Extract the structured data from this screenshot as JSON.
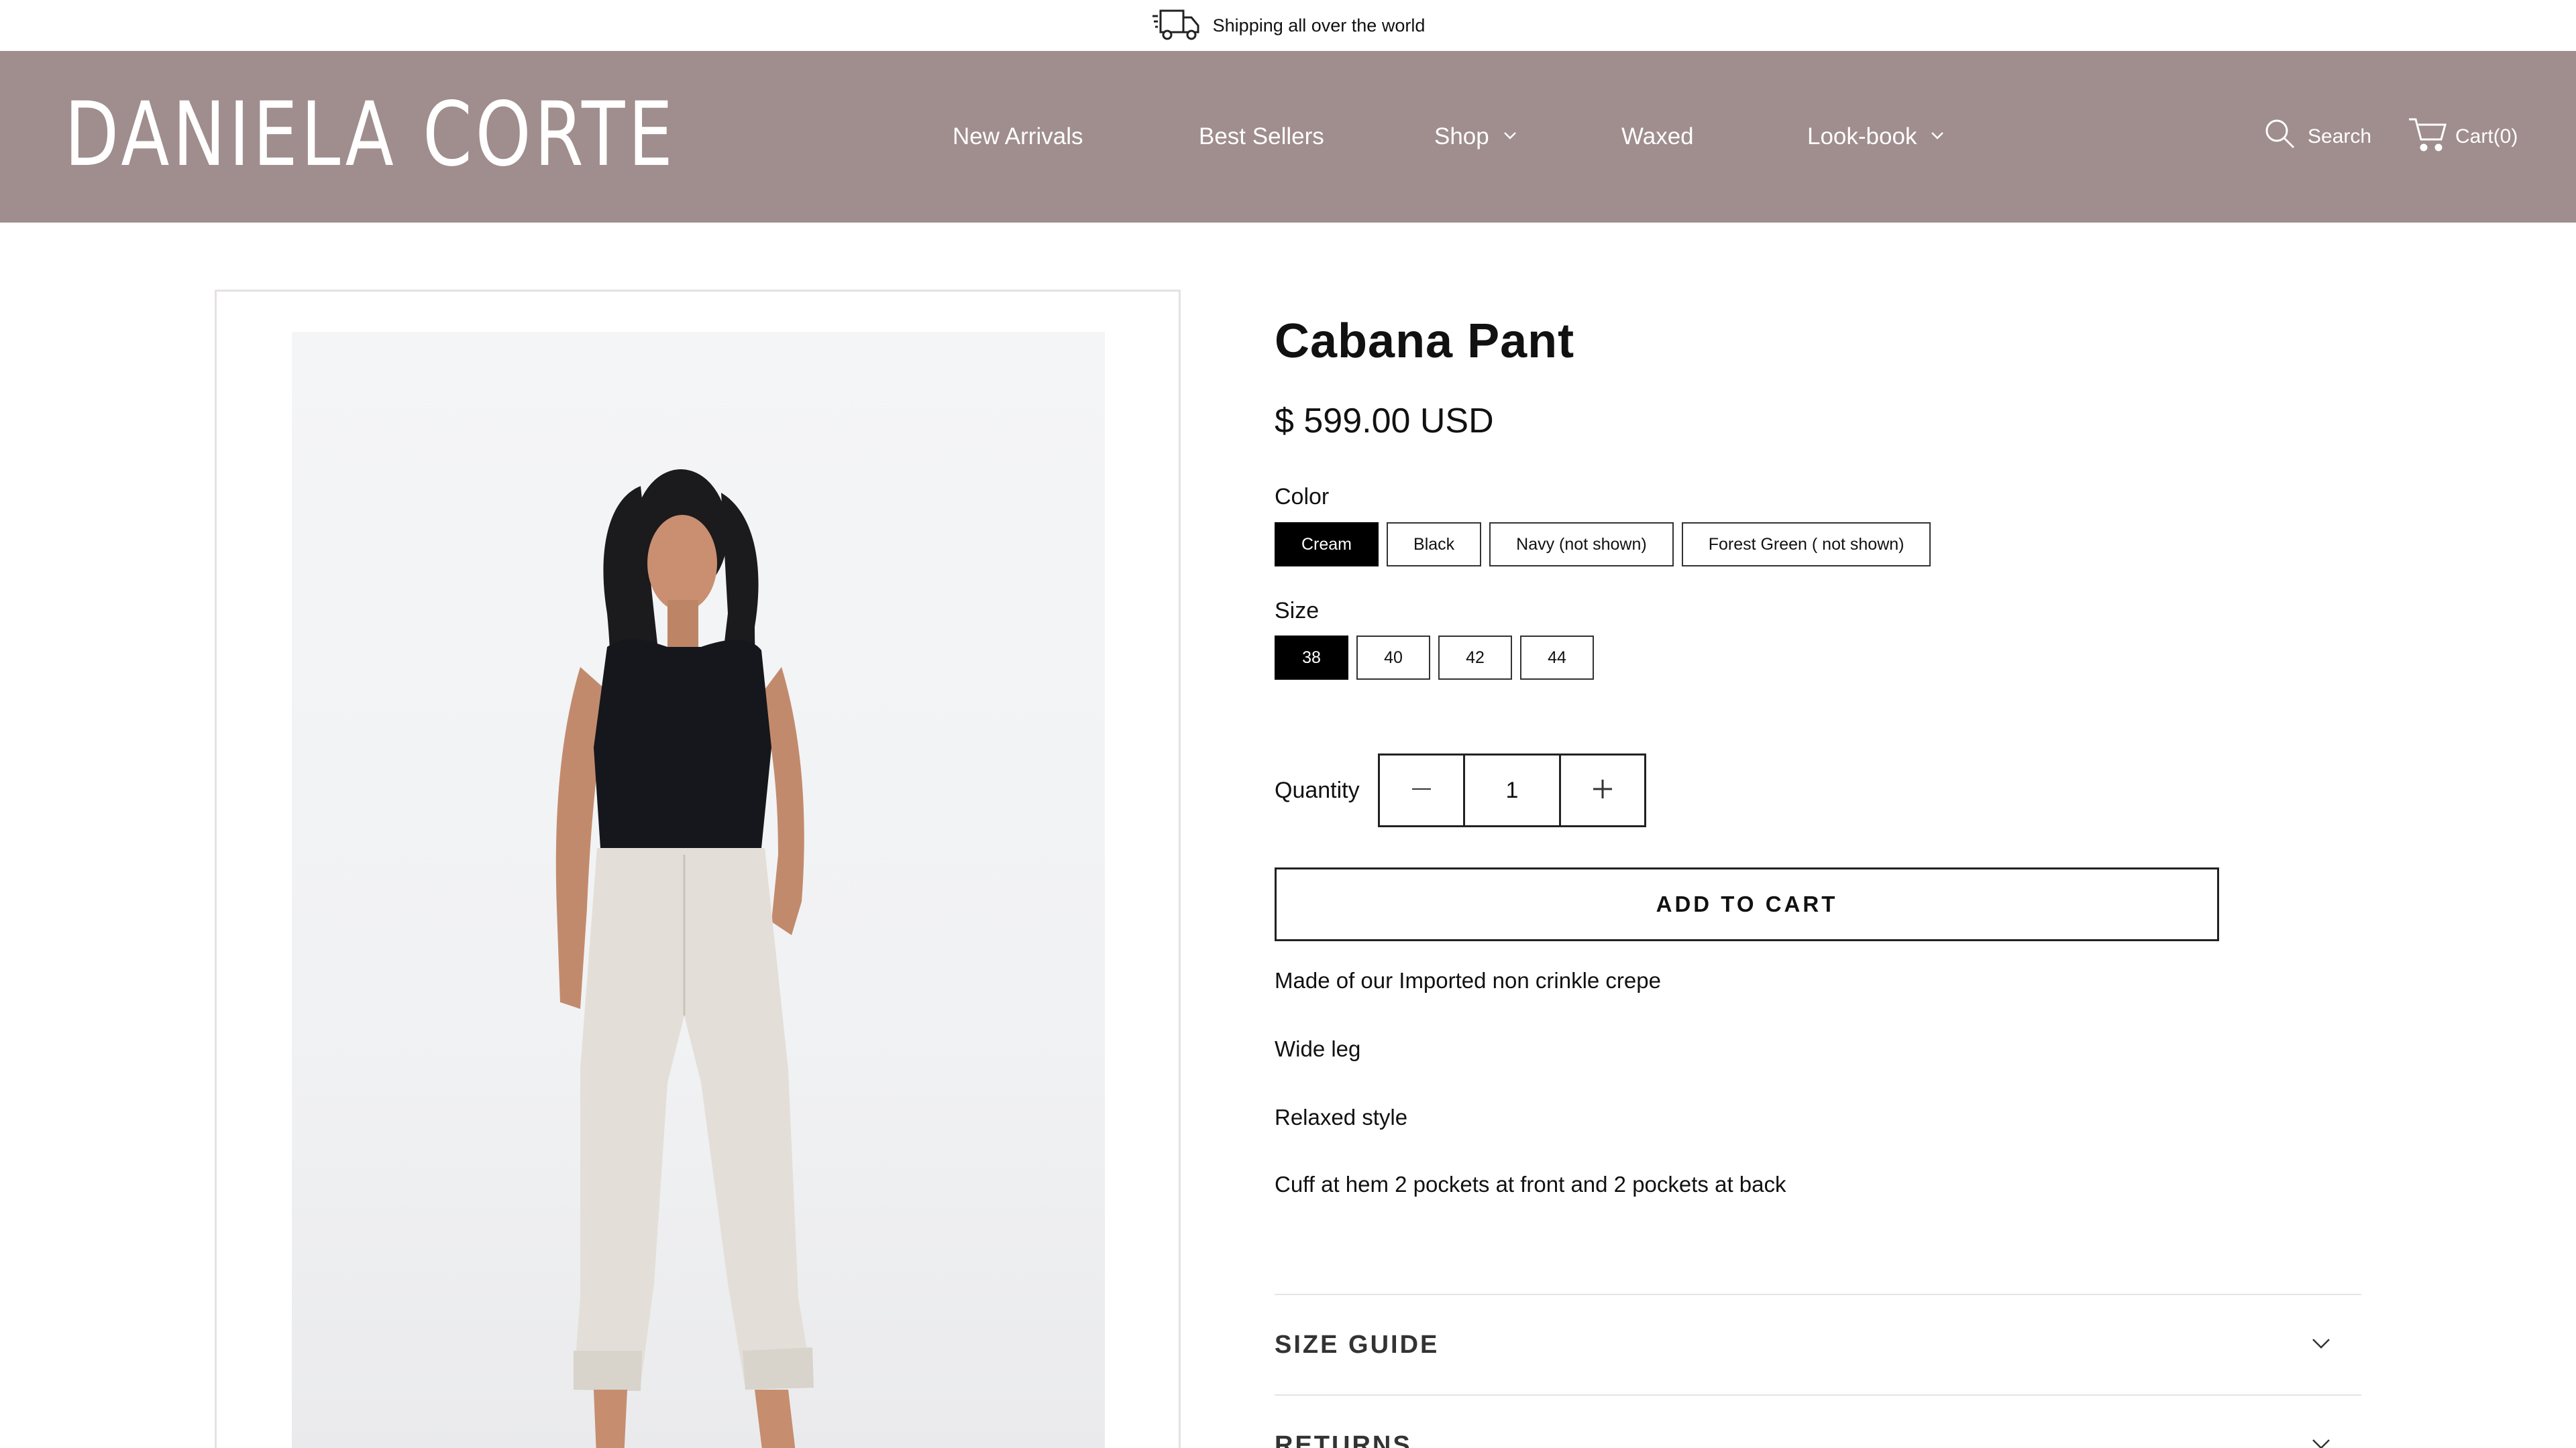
{
  "announcement": {
    "text": "Shipping all over the world",
    "icon": "truck-icon"
  },
  "header": {
    "logo": "DANIELA CORTE",
    "background": "#a08d8d",
    "nav": [
      {
        "label": "New Arrivals",
        "has_dropdown": false
      },
      {
        "label": "Best Sellers",
        "has_dropdown": false
      },
      {
        "label": "Shop",
        "has_dropdown": true
      },
      {
        "label": "Waxed",
        "has_dropdown": false
      },
      {
        "label": "Look-book",
        "has_dropdown": true
      }
    ],
    "search_label": "Search",
    "cart_label": "Cart(0)"
  },
  "product": {
    "title": "Cabana Pant",
    "price": "$ 599.00 USD",
    "color_label": "Color",
    "colors": [
      "Cream",
      "Black",
      "Navy (not shown)",
      "Forest Green ( not shown)"
    ],
    "selected_color": "Cream",
    "size_label": "Size",
    "sizes": [
      "38",
      "40",
      "42",
      "44"
    ],
    "selected_size": "38",
    "quantity_label": "Quantity",
    "quantity": "1",
    "add_to_cart": "ADD TO CART",
    "description": [
      "Made of our Imported non crinkle crepe",
      "Wide leg",
      "Relaxed style",
      "Cuff at hem 2 pockets at front and 2 pockets at back"
    ],
    "accordions": [
      "SIZE GUIDE",
      "RETURNS"
    ]
  },
  "colors": {
    "accent_selected": "#000000",
    "header_bg": "#a08d8d"
  }
}
